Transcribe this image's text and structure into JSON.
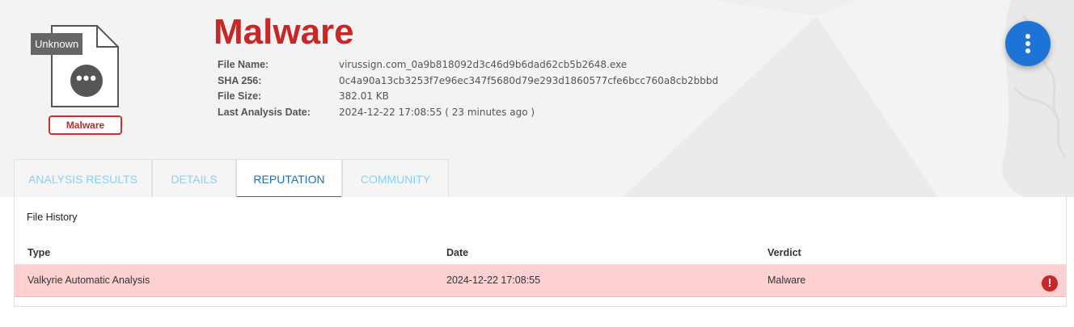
{
  "file_icon": {
    "type_tag": "Unknown",
    "verdict_badge": "Malware",
    "icon": "more-dots-icon"
  },
  "header": {
    "title": "Malware",
    "title_color": "#c62828",
    "fields": [
      {
        "label": "File Name:",
        "value": "virussign.com_0a9b818092d3c46d9b6dad62cb5b2648.exe"
      },
      {
        "label": "SHA 256:",
        "value": "0c4a90a13cb3253f7e96ec347f5680d79e293d1860577cfe6bcc760a8cb2bbbd"
      },
      {
        "label": "File Size:",
        "value": "382.01 KB"
      },
      {
        "label": "Last Analysis Date:",
        "value": "2024-12-22 17:08:55 ( 23 minutes ago )"
      }
    ]
  },
  "fab": {
    "icon": "more-vertical-icon",
    "color": "#1e74d6"
  },
  "tabs": [
    {
      "label": "ANALYSIS RESULTS",
      "active": false
    },
    {
      "label": "DETAILS",
      "active": false
    },
    {
      "label": "REPUTATION",
      "active": true
    },
    {
      "label": "COMMUNITY",
      "active": false
    }
  ],
  "panel": {
    "title": "File History",
    "columns": [
      "Type",
      "Date",
      "Verdict"
    ],
    "rows": [
      {
        "type": "Valkyrie Automatic Analysis",
        "date": "2024-12-22 17:08:55",
        "verdict": "Malware",
        "status_icon": "alert-circle-icon",
        "row_color": "#fdd0d2"
      }
    ]
  }
}
